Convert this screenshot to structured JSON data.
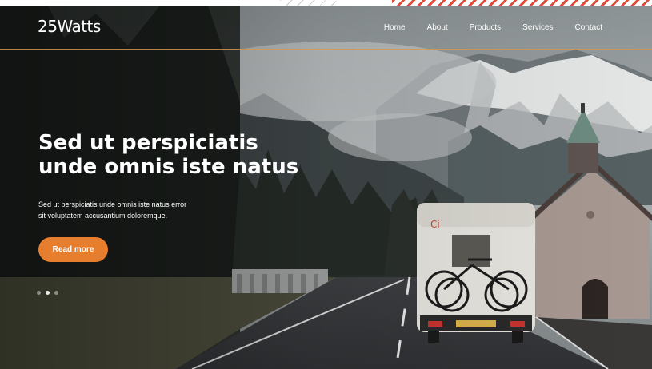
{
  "brand": {
    "logo_text": "25Watts"
  },
  "nav": {
    "items": [
      {
        "label": "Home"
      },
      {
        "label": "About"
      },
      {
        "label": "Products"
      },
      {
        "label": "Services"
      },
      {
        "label": "Contact"
      }
    ]
  },
  "hero": {
    "title_line1": "Sed ut perspiciatis",
    "title_line2": "unde omnis iste natus",
    "subtitle_line1": "Sed ut perspiciatis unde omnis iste natus error",
    "subtitle_line2": "sit voluptatem accusantium doloremque.",
    "cta_label": "Read more",
    "slider": {
      "slide_count": 3,
      "active_index": 1
    }
  },
  "colors": {
    "accent": "#e77e2e",
    "nav_divider": "#d79646",
    "text": "#ffffff"
  },
  "icons": {
    "logo": "brand-logo"
  }
}
